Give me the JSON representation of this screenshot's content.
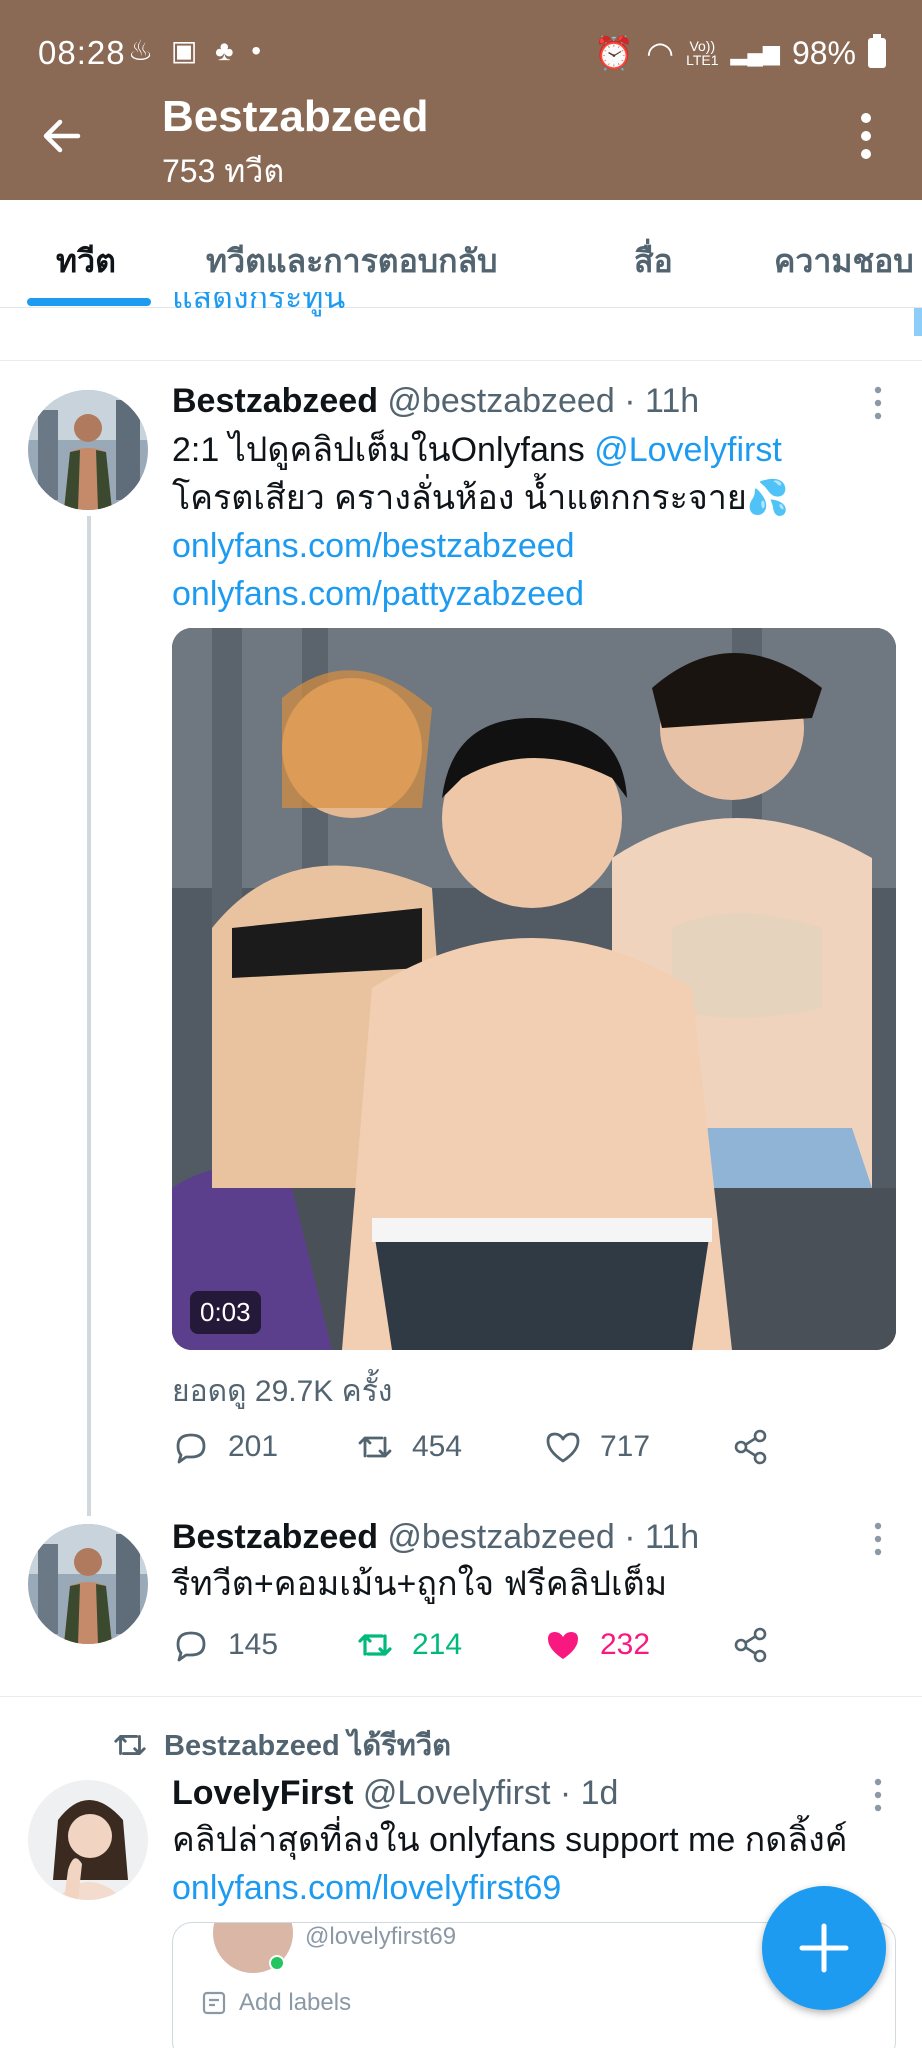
{
  "status_bar": {
    "time": "08:28",
    "network_label_top": "Vo))",
    "network_label_bottom": "LTE1",
    "battery": "98%"
  },
  "profile": {
    "name": "Bestzabzeed",
    "tweet_count": "753 ทวีต"
  },
  "tabs": [
    "ทวีต",
    "ทวีตและการตอบกลับ",
    "สื่อ",
    "ความชอบ"
  ],
  "active_tab_index": 0,
  "cut_off_text": "แสดงกระทู้นี้",
  "tweets": [
    {
      "name": "Bestzabzeed",
      "handle": "@bestzabzeed",
      "time": "· 11h",
      "text_line1_prefix": "2:1 ไปดูคลิปเต็มในOnlyfans ",
      "text_line1_mention": "@Lovelyfirst",
      "text_line2": "โครตเสียว ครางลั่นห้อง น้ำแตกกระจาย💦",
      "link1": "onlyfans.com/bestzabzeed",
      "link2": "onlyfans.com/pattyzabzeed",
      "video_duration": "0:03",
      "views": "ยอดดู 29.7K ครั้ง",
      "replies": "201",
      "retweets": "454",
      "likes": "717"
    },
    {
      "name": "Bestzabzeed",
      "handle": "@bestzabzeed",
      "time": "· 11h",
      "text": "รีทวีต+คอมเม้น+ถูกใจ ฟรีคลิปเต็ม",
      "replies": "145",
      "retweets": "214",
      "likes": "232"
    },
    {
      "retweeted_by": "Bestzabzeed ได้รีทวีต",
      "name": "LovelyFirst",
      "handle": "@Lovelyfirst",
      "time": "· 1d",
      "text": "คลิปล่าสุดที่ลงใน onlyfans support me กดลิ้งค์",
      "link": "onlyfans.com/lovelyfirst69",
      "card_handle": "@lovelyfirst69",
      "card_labels": "Add labels"
    }
  ],
  "colors": {
    "header_bg": "#8b6a55",
    "accent": "#1d9bf0",
    "retweet_active": "#00ba7c",
    "like_active": "#f91880",
    "muted": "#536471"
  },
  "icons": [
    "back-arrow-icon",
    "more-vertical-icon",
    "reply-icon",
    "retweet-icon",
    "like-icon",
    "share-icon",
    "compose-plus-icon",
    "label-icon"
  ]
}
